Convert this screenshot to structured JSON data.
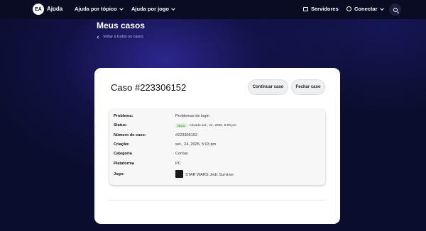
{
  "header": {
    "logo": "EA",
    "brand": "Ajuda",
    "nav": [
      {
        "label": "Ajuda por tópico"
      },
      {
        "label": "Ajuda por jogo"
      }
    ],
    "servers_label": "Servidores",
    "connect_label": "Conectar"
  },
  "page": {
    "title": "Meus casos",
    "back_link": "Voltar a todos os casos"
  },
  "case": {
    "title": "Caso #223306152",
    "continue_label": "Continuar caso",
    "close_label": "Fechar caso",
    "details": {
      "problem_label": "Problema:",
      "problem_value": "Problemas de login",
      "status_label": "Status:",
      "status_badge": "Novo",
      "status_value": "Ativado set., 24, 2025, 5:03 pm",
      "number_label": "Número do caso:",
      "number_value": "#223306152",
      "created_label": "Criação:",
      "created_value": "set., 24, 2025, 5:03 pm",
      "category_label": "Categoria",
      "category_value": "Contas",
      "platform_label": "Plataforma",
      "platform_value": "PC",
      "game_label": "Jogo:",
      "game_value": "STAR WARS Jedi: Survivor"
    }
  }
}
